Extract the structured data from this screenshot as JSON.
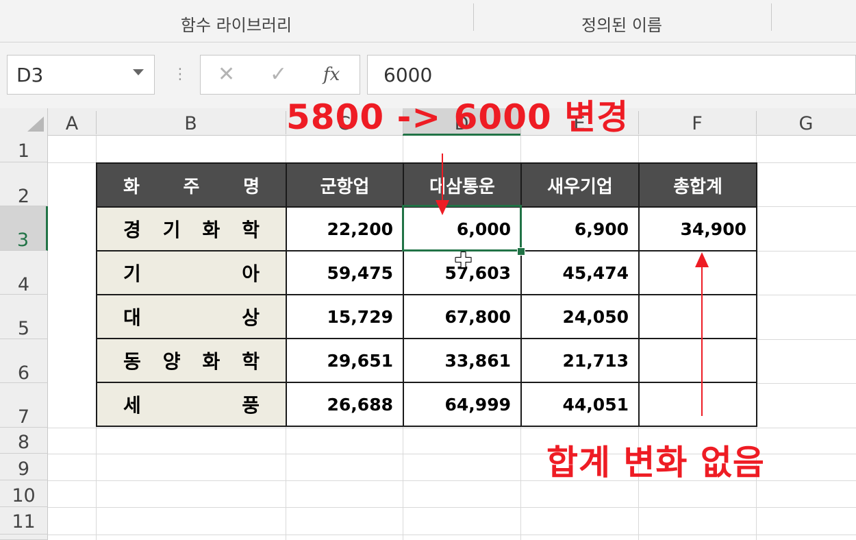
{
  "ribbon": {
    "group1": "함수 라이브러리",
    "group2": "정의된 이름"
  },
  "formula_bar": {
    "name_box": "D3",
    "cancel_icon": "✕",
    "enter_icon": "✓",
    "fx_label": "fx",
    "value": "6000"
  },
  "columns": [
    "A",
    "B",
    "C",
    "D",
    "E",
    "F",
    "G"
  ],
  "rows": [
    "1",
    "2",
    "3",
    "4",
    "5",
    "6",
    "7",
    "8",
    "9",
    "10",
    "11"
  ],
  "selected_cell": "D3",
  "table": {
    "headers": {
      "name": [
        "화",
        "주",
        "명"
      ],
      "c": "군항업",
      "d": "대삼통운",
      "e": "새우기업",
      "f": "총합계"
    },
    "rows": [
      {
        "name": [
          "경",
          "기",
          "화",
          "학"
        ],
        "c": "22,200",
        "d": "6,000",
        "e": "6,900",
        "f": "34,900"
      },
      {
        "name": [
          "기",
          "아"
        ],
        "c": "59,475",
        "d": "57,603",
        "e": "45,474",
        "f": ""
      },
      {
        "name": [
          "대",
          "상"
        ],
        "c": "15,729",
        "d": "67,800",
        "e": "24,050",
        "f": ""
      },
      {
        "name": [
          "동",
          "양",
          "화",
          "학"
        ],
        "c": "29,651",
        "d": "33,861",
        "e": "21,713",
        "f": ""
      },
      {
        "name": [
          "세",
          "풍"
        ],
        "c": "26,688",
        "d": "64,999",
        "e": "44,051",
        "f": ""
      }
    ]
  },
  "annotations": {
    "top": "5800 -> 6000 변경",
    "bottom": "합계 변화 없음",
    "color": "#ee1c24"
  },
  "colors": {
    "excel_green": "#217346",
    "header_fill": "#4d4d4d",
    "name_fill": "#eeece1"
  }
}
